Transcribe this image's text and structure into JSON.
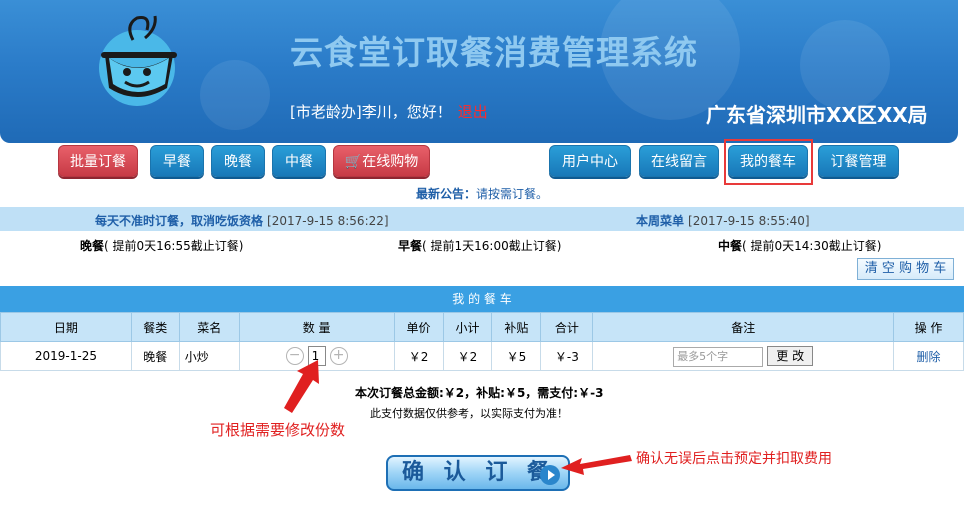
{
  "header": {
    "app_title": "云食堂订取餐消费管理系统",
    "greeting_prefix": "[市老龄办]李川，您好！",
    "logout_label": "退出",
    "bureau": "广东省深圳市XX区XX局"
  },
  "nav": {
    "batch_order": "批量订餐",
    "breakfast": "早餐",
    "dinner": "晚餐",
    "lunch": "中餐",
    "online_cart": "在线购物",
    "user_center": "用户中心",
    "online_message": "在线留言",
    "my_cart": "我的餐车",
    "order_manage": "订餐管理"
  },
  "notice": {
    "label": "最新公告：",
    "text": "请按需订餐。"
  },
  "info_strip": {
    "left_text": "每天不准时订餐，取消吃饭资格",
    "left_time": "[2017-9-15 8:56:22]",
    "right_text": "本周菜单",
    "right_time": "[2017-9-15 8:55:40]"
  },
  "deadlines": {
    "dinner_label": "晚餐",
    "dinner_text": "( 提前0天16:55截止订餐)",
    "breakfast_label": "早餐",
    "breakfast_text": "( 提前1天16:00截止订餐)",
    "lunch_label": "中餐",
    "lunch_text": "( 提前0天14:30截止订餐)"
  },
  "clear_cart_label": "清 空 购 物 车",
  "cart": {
    "title": "我 的 餐 车",
    "headers": [
      "日期",
      "餐类",
      "菜名",
      "数 量",
      "单价",
      "小计",
      "补贴",
      "合计",
      "备注",
      "操 作"
    ],
    "row": {
      "date": "2019-1-25",
      "meal": "晚餐",
      "dish": "小炒",
      "qty": "1",
      "minus": "−",
      "plus": "+",
      "unit_price": "￥2",
      "subtotal": "￥2",
      "subsidy": "￥5",
      "total": "￥-3",
      "note_placeholder": "最多5个字",
      "modify_label": "更 改",
      "delete_label": "删除"
    }
  },
  "summary": {
    "totals": "本次订餐总金额:￥2，补贴:￥5，需支付:￥-3",
    "disclaimer": "此支付数据仅供参考，以实际支付为准！"
  },
  "annotations": {
    "qty_hint": "可根据需要修改份数",
    "confirm_hint": "确认无误后点击预定并扣取费用"
  },
  "confirm_label": "确 认 订 餐",
  "colors": {
    "header_blue": "#2b7cc9",
    "nav_blue": "#1878b8",
    "nav_red": "#c73a45",
    "annotation_red": "#e02020",
    "table_head": "#c6e4f8"
  }
}
